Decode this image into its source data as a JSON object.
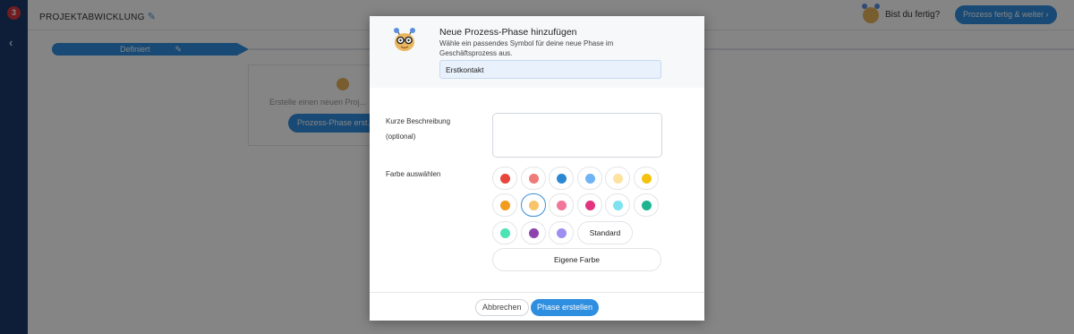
{
  "app": {
    "logo_text": "3",
    "collapse_icon": "‹",
    "project_title": "PROJEKTABWICKLUNG",
    "question": "Bist du fertig?",
    "done_button": "Prozess fertig & weiter ›"
  },
  "background": {
    "phase_label": "Definiert",
    "empty_text": "Erstelle einen neuen Proj...",
    "create_button": "Prozess-Phase erst..."
  },
  "modal": {
    "title": "Neue Prozess-Phase hinzufügen",
    "description": "Wähle ein passendes Symbol für deine neue Phase im Geschäftsprozess aus.",
    "phase_name_value": "Erstkontakt",
    "short_desc_label_1": "Kurze Beschreibung",
    "short_desc_label_2": "(optional)",
    "short_desc_value": "",
    "color_label": "Farbe auswählen",
    "colors": [
      {
        "name": "red",
        "hex": "#e8453c"
      },
      {
        "name": "salmon",
        "hex": "#f07b7b"
      },
      {
        "name": "blue",
        "hex": "#2b87d1"
      },
      {
        "name": "light-blue",
        "hex": "#6eb3f3"
      },
      {
        "name": "cream",
        "hex": "#fde2a0"
      },
      {
        "name": "yellow",
        "hex": "#f4c20d"
      },
      {
        "name": "orange",
        "hex": "#f29b1d"
      },
      {
        "name": "light-orange",
        "hex": "#f7c46a"
      },
      {
        "name": "pink",
        "hex": "#f2759a"
      },
      {
        "name": "magenta",
        "hex": "#e2337f"
      },
      {
        "name": "aqua",
        "hex": "#7de4ef"
      },
      {
        "name": "teal",
        "hex": "#1db590"
      },
      {
        "name": "mint",
        "hex": "#4ce3b5"
      },
      {
        "name": "purple",
        "hex": "#8e44ad"
      },
      {
        "name": "lavender",
        "hex": "#9d8ff0"
      }
    ],
    "selected_color": "light-orange",
    "standard_button": "Standard",
    "custom_color_button": "Eigene Farbe",
    "cancel_button": "Abbrechen",
    "create_button": "Phase erstellen"
  }
}
